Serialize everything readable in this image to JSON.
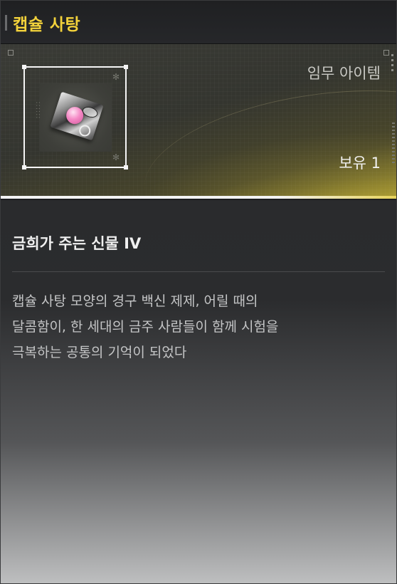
{
  "title": "캡슐 사탕",
  "item": {
    "icon": "capsule-candy-icon",
    "category": "임무 아이템",
    "owned_label": "보유 1"
  },
  "subtitle": "금희가 주는 신물 IV",
  "description_lines": [
    "캡슐 사탕 모양의 경구 백신 제제, 어릴 때의",
    "달콤함이, 한 세대의 금주 사람들이 함께 시험을",
    "극복하는 공통의 기억이 되었다"
  ],
  "colors": {
    "title": "#f3d23b",
    "accent_glow": "#e2cb3f"
  }
}
